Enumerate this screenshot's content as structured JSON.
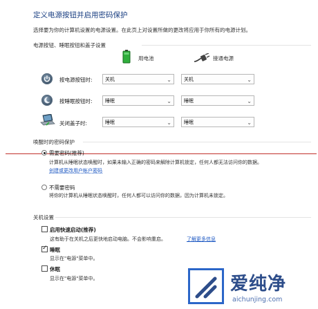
{
  "header": {
    "title": "定义电源按钮并启用密码保护",
    "subtitle": "选择要为你的计算机设置的电源设置。在此页上对设置所做的更改将应用于你所有的电源计划。"
  },
  "power_section": {
    "heading": "电源按钮、睡眠按钮和盖子设置",
    "col_battery": "用电池",
    "col_plugged": "接通电源",
    "rows": [
      {
        "label": "按电源按钮时:",
        "battery": "关机",
        "plugged": "关机",
        "icon": "power-button-icon"
      },
      {
        "label": "按睡眠按钮时:",
        "battery": "睡眠",
        "plugged": "睡眠",
        "icon": "sleep-moon-icon"
      },
      {
        "label": "关闭盖子时:",
        "battery": "睡眠",
        "plugged": "睡眠",
        "icon": "laptop-lid-icon"
      }
    ]
  },
  "password_section": {
    "heading": "唤醒时的密码保护",
    "option1_label": "需要密码(推荐)",
    "option1_desc": "计算机从睡眠状态唤醒时，如果未输入正确的密码来解除计算机锁定，任何人都无法访问你的数据。",
    "option1_link": "创建或更改用户帐户密码",
    "option2_label": "不需要密码",
    "option2_desc": "将你的计算机从睡眠状态唤醒时，任何人都可以访问你的数据，因为计算机未锁定。"
  },
  "shutdown_section": {
    "heading": "关机设置",
    "fast_label": "启用快速启动(推荐)",
    "fast_desc": "这有助于在关机之后更快地启动电脑。不会影响重启。",
    "fast_link": "了解更多信息",
    "sleep_label": "睡眠",
    "sleep_desc": "显示在\"电源\"菜单中。",
    "hibernate_label": "休眠",
    "hibernate_desc": "显示在\"电源\"菜单中。"
  },
  "state": {
    "require_password": true,
    "fast_startup": false,
    "show_sleep": true,
    "show_hibernate": false
  },
  "watermark": {
    "text": "爱纯净",
    "url": "aichunjing.com"
  },
  "colors": {
    "title": "#1a3f82",
    "link": "#1a56c2",
    "red_line": "#c0302a",
    "logo_blue": "#2b66c8"
  }
}
